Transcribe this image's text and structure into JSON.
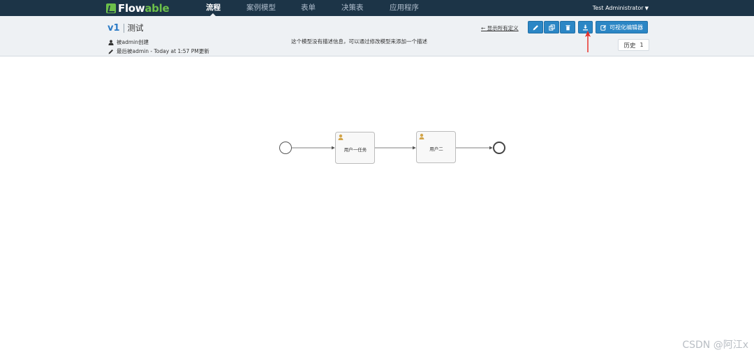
{
  "app": {
    "logo_text_1": "Flow",
    "logo_text_2": "able"
  },
  "nav": {
    "items": [
      {
        "label": "流程",
        "active": true
      },
      {
        "label": "案例模型",
        "active": false
      },
      {
        "label": "表单",
        "active": false
      },
      {
        "label": "决策表",
        "active": false
      },
      {
        "label": "应用程序",
        "active": false
      }
    ],
    "user": "Test Administrator"
  },
  "model": {
    "version": "v1",
    "name": "测试",
    "created_by": "被admin创建",
    "last_updated": "最后被admin - Today at 1:57 PM更新",
    "description": "这个模型没有描述信息，可以通过修改模型来添加一个描述",
    "show_all_label": "← 显示所有定义"
  },
  "toolbar": {
    "edit_icon": "pencil-icon",
    "copy_icon": "copy-icon",
    "delete_icon": "trash-icon",
    "export_icon": "download-icon",
    "editor_label": "可视化编辑器",
    "history_label": "历史",
    "history_count": "1"
  },
  "diagram": {
    "tasks": [
      {
        "label": "用户一任务"
      },
      {
        "label": "用户二"
      }
    ]
  },
  "watermark": "CSDN @阿江x",
  "colors": {
    "navbar": "#1c3447",
    "brand_green": "#6cc04a",
    "button_blue": "#2b86c5",
    "version_blue": "#2b7bc6",
    "annotation_red": "#e8302a"
  }
}
